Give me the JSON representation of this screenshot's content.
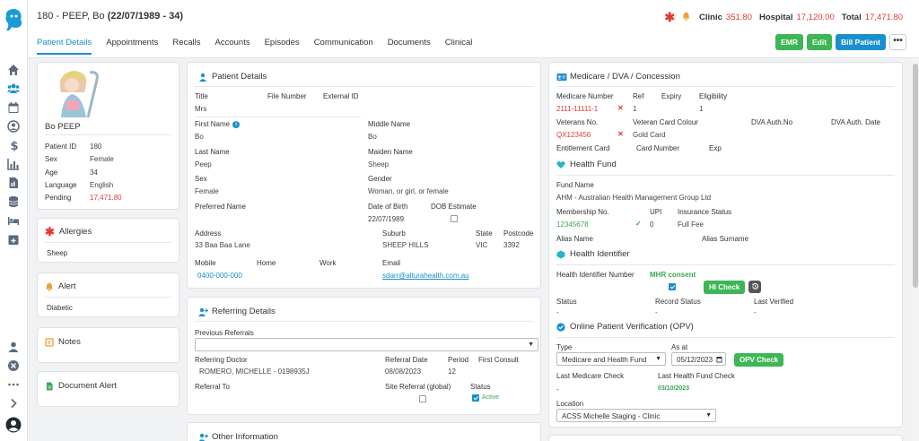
{
  "header": {
    "patient_name": "180 - PEEP, Bo",
    "patient_dob": "(22/07/1989 - 34)",
    "clinic_label": "Clinic",
    "clinic_amount": "351.80",
    "hospital_label": "Hospital",
    "hospital_amount": "17,120.00",
    "total_label": "Total",
    "total_amount": "17,471.80"
  },
  "tabs": [
    "Patient Details",
    "Appointments",
    "Recalls",
    "Accounts",
    "Episodes",
    "Communication",
    "Documents",
    "Clinical"
  ],
  "buttons": {
    "emr": "EMR",
    "edit": "Edit",
    "bill": "Bill Patient",
    "more": "•••"
  },
  "profile": {
    "name": "Bo PEEP",
    "rows": [
      {
        "label": "Patient ID",
        "value": "180"
      },
      {
        "label": "Sex",
        "value": "Female"
      },
      {
        "label": "Age",
        "value": "34"
      },
      {
        "label": "Language",
        "value": "English"
      },
      {
        "label": "Pending",
        "value": "17,471.80"
      }
    ]
  },
  "allergies": {
    "title": "Allergies",
    "value": "Sheep"
  },
  "alert": {
    "title": "Alert",
    "value": "Diabetic"
  },
  "notes": {
    "title": "Notes"
  },
  "document_alert": {
    "title": "Document Alert"
  },
  "patient_details": {
    "title": "Patient Details",
    "title_label": "Title",
    "title_value": "Mrs",
    "file_number_label": "File Number",
    "external_id_label": "External ID",
    "first_name_label": "First Name",
    "first_name": "Bo",
    "middle_name_label": "Middle Name",
    "middle_name": "Bo",
    "last_name_label": "Last Name",
    "last_name": "Peep",
    "maiden_name_label": "Maiden Name",
    "maiden_name": "Sheep",
    "sex_label": "Sex",
    "sex": "Female",
    "gender_label": "Gender",
    "gender": "Woman, or girl, or female",
    "preferred_name_label": "Preferred Name",
    "dob_label": "Date of Birth",
    "dob": "22/07/1989",
    "dob_estimate_label": "DOB Estimate",
    "address_label": "Address",
    "address": "33 Baa Baa Lane",
    "suburb_label": "Suburb",
    "suburb": "SHEEP HILLS",
    "state_label": "State",
    "state": "VIC",
    "postcode_label": "Postcode",
    "postcode": "3392",
    "mobile_label": "Mobile",
    "mobile": "0400-000-000",
    "home_label": "Home",
    "work_label": "Work",
    "email_label": "Email",
    "email": "sdarr@alturahealth.com.au"
  },
  "referring": {
    "title": "Referring Details",
    "previous_label": "Previous Referrals",
    "doctor_label": "Referring Doctor",
    "doctor": "ROMERO, MICHELLE - 0198935J",
    "date_label": "Referral Date",
    "date": "08/08/2023",
    "period_label": "Period",
    "period": "12",
    "first_consult_label": "First Consult",
    "referral_to_label": "Referral To",
    "site_label": "Site Referral (global)",
    "status_label": "Status",
    "status": "Active"
  },
  "other": {
    "title": "Other Information"
  },
  "medicare": {
    "title": "Medicare / DVA / Concession",
    "number_label": "Medicare Number",
    "number": "2111-11111-1",
    "ref_label": "Ref",
    "ref": "1",
    "expiry_label": "Expiry",
    "eligibility_label": "Eligibility",
    "eligibility": "1",
    "veterans_label": "Veterans No.",
    "veterans": "QX123456",
    "card_colour_label": "Veteran Card Colour",
    "card_colour": "Gold Card",
    "dva_auth_label": "DVA Auth.No",
    "dva_date_label": "DVA Auth. Date",
    "entitlement_label": "Entitlement Card",
    "card_number_label": "Card Number",
    "exp_label": "Exp"
  },
  "health_fund": {
    "title": "Health Fund",
    "fund_label": "Fund Name",
    "fund": "AHM - Australian Health Management Group Ltd",
    "membership_label": "Membership No.",
    "membership": "12345678",
    "upi_label": "UPI",
    "upi": "0",
    "insurance_label": "Insurance Status",
    "insurance": "Full Fee",
    "alias_name_label": "Alias Name",
    "alias_surname_label": "Alias Surname"
  },
  "health_identifier": {
    "title": "Health Identifier",
    "number_label": "Health Identifier Number",
    "mhr_label": "MHR consent",
    "hi_check": "HI Check",
    "status_label": "Status",
    "status": "-",
    "record_label": "Record Status",
    "record": "-",
    "verified_label": "Last Verified",
    "verified": "-"
  },
  "opv": {
    "title": "Online Patient Verification (OPV)",
    "type_label": "Type",
    "type": "Medicare and Health Fund",
    "as_at_label": "As at",
    "as_at": "05/12/2023",
    "opv_check": "OPV Check",
    "medicare_check_label": "Last Medicare Check",
    "medicare_check": "-",
    "fund_check_label": "Last Health Fund Check",
    "fund_check": "03/10/2023",
    "location_label": "Location",
    "location": "ACSS Michelle Staging - Clinic"
  }
}
